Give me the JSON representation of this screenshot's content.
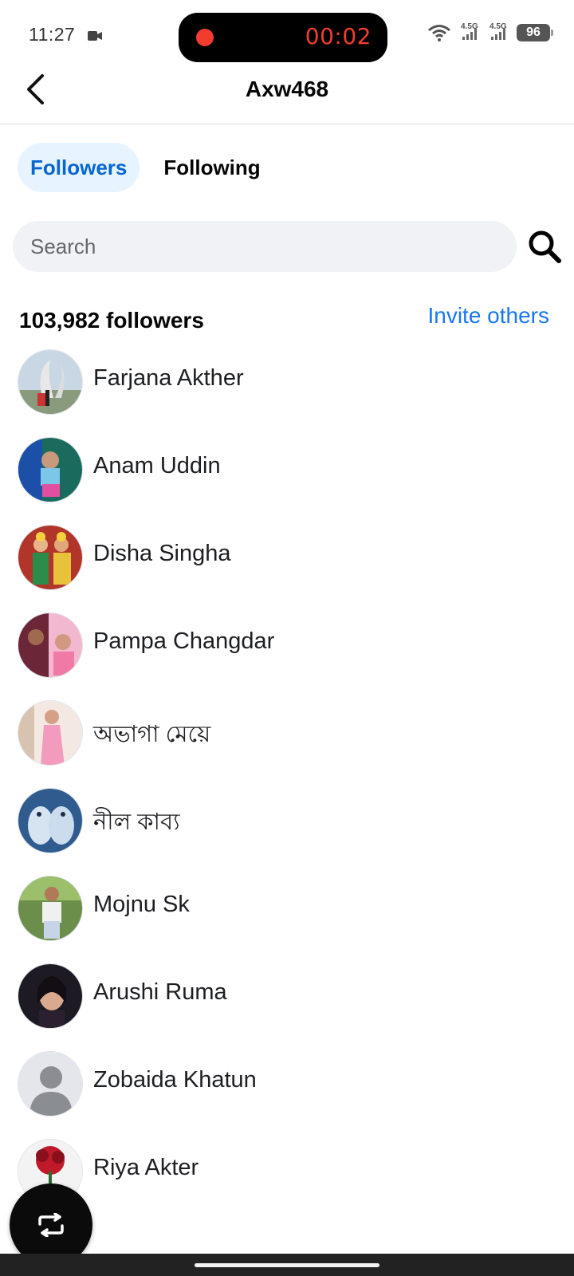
{
  "status_bar": {
    "time": "11:27",
    "recording_time": "00:02",
    "battery": "96",
    "network_1": "4.5G",
    "network_2": "4.5G"
  },
  "header": {
    "title": "Axw468"
  },
  "tabs": [
    {
      "label": "Followers",
      "active": true
    },
    {
      "label": "Following",
      "active": false
    }
  ],
  "search": {
    "placeholder": "Search"
  },
  "followers": {
    "count_label": "103,982 followers",
    "invite_label": "Invite others",
    "items": [
      {
        "name": "Farjana Akther",
        "avatar": "photo-monument"
      },
      {
        "name": "Anam Uddin",
        "avatar": "photo-child"
      },
      {
        "name": "Disha Singha",
        "avatar": "photo-deities"
      },
      {
        "name": "Pampa Changdar",
        "avatar": "photo-couple"
      },
      {
        "name": "অভাগা মেয়ে",
        "avatar": "photo-woman-pink"
      },
      {
        "name": "নীল কাব্য",
        "avatar": "photo-birds"
      },
      {
        "name": "Mojnu Sk",
        "avatar": "photo-man-outdoor"
      },
      {
        "name": "Arushi Ruma",
        "avatar": "photo-woman-portrait"
      },
      {
        "name": "Zobaida Khatun",
        "avatar": "default-avatar"
      },
      {
        "name": "Riya Akter",
        "avatar": "photo-flower"
      }
    ]
  },
  "colors": {
    "accent": "#1877f2",
    "active_tab_bg": "#e7f3ff",
    "active_tab_text": "#0866d1",
    "recording": "#f23d2e"
  }
}
